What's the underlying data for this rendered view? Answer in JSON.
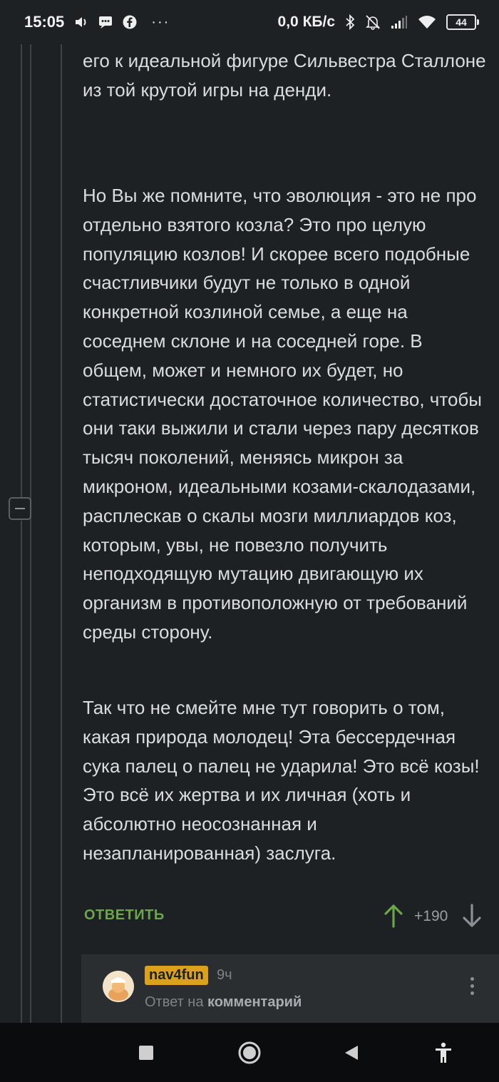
{
  "status_bar": {
    "time": "15:05",
    "net_speed": "0,0 КБ/с",
    "battery": "44",
    "more": "···"
  },
  "comment": {
    "paragraph_1": "его к идеальной фигуре Сильвестра Сталлоне из той крутой игры на денди.",
    "paragraph_2": "Но Вы же помните, что эволюция - это не про отдельно взятого козла? Это про целую популяцию козлов! И скорее всего подобные счастливчики будут не только в одной конкретной козлиной семье, а еще на соседнем склоне и на соседней горе. В общем, может и немного их будет, но статистически достаточное количество, чтобы они таки выжили и стали через пару десятков тысяч поколений, меняясь микрон за микроном, идеальными козами-скалодазами, расплескав о скалы мозги миллиардов коз, которым, увы, не повезло получить неподходящую мутацию двигающую их организм в противоположную от требований среды сторону.",
    "paragraph_3": "Так что не смейте мне тут говорить о том, какая природа молодец! Эта бессердечная сука палец о палец не ударила! Это всё козы! Это всё их жертва и их личная (хоть и абсолютно неосознанная и незапланированная) заслуга.",
    "reply_label": "ОТВЕТИТЬ",
    "rating": "+190"
  },
  "child_comment": {
    "author": "nav4fun",
    "time_ago": "9ч",
    "reply_prefix": "Ответ на",
    "reply_target": "комментарий"
  },
  "colors": {
    "background": "#1e2124",
    "reply_green": "#6aa64a",
    "nick_badge": "#d9a21a"
  }
}
